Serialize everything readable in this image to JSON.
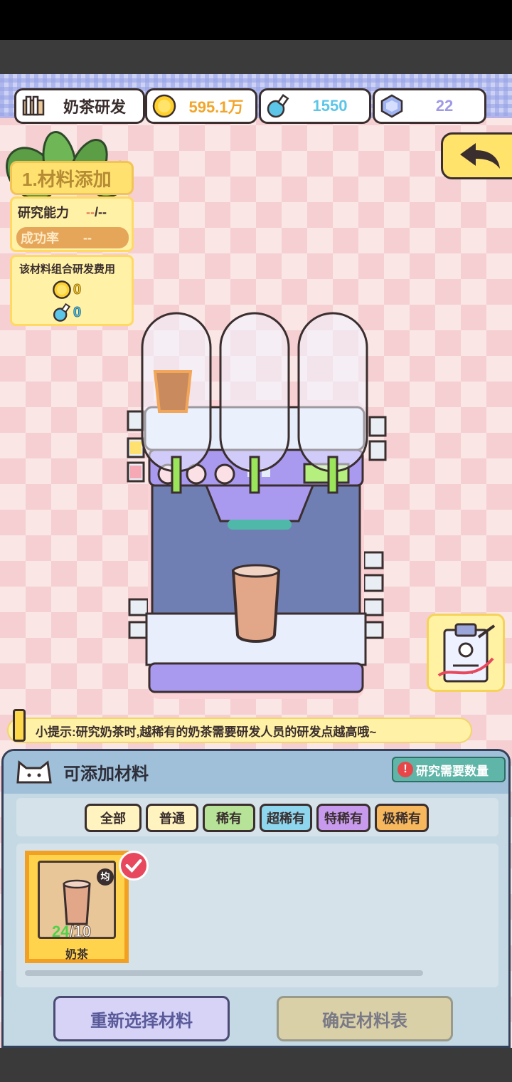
{
  "header": {
    "title": "奶茶研发",
    "coins": "595.1万",
    "potion": "1550",
    "gems": "22"
  },
  "left_panel": {
    "step_title": "1.材料添加",
    "research_label": "研究能力",
    "research_value_a": "--",
    "research_value_b": "/--",
    "success_label": "成功率",
    "success_value": "--",
    "cost_title": "该材料组合研发费用",
    "cost_coin": "0",
    "cost_potion": "0"
  },
  "tip": {
    "text": "小提示:研究奶茶时,越稀有的奶茶需要研发人员的研发点越高哦~"
  },
  "materials": {
    "title": "可添加材料",
    "need_label": "研究需要数量",
    "filters": [
      {
        "label": "全部",
        "bg": "#fff3bf"
      },
      {
        "label": "普通",
        "bg": "#fff3bf"
      },
      {
        "label": "稀有",
        "bg": "#b6e398"
      },
      {
        "label": "超稀有",
        "bg": "#8dd6ee"
      },
      {
        "label": "特稀有",
        "bg": "#c79aee"
      },
      {
        "label": "极稀有",
        "bg": "#f7b85d"
      }
    ],
    "items": [
      {
        "name": "奶茶",
        "have": "24",
        "need": "/10",
        "badge": "均"
      }
    ]
  },
  "buttons": {
    "reselect": "重新选择材料",
    "confirm": "确定材料表"
  },
  "colors": {
    "accent_yellow": "#ffe36b",
    "machine_purple": "#a99af0",
    "coin_text": "#f2a52a",
    "potion_text": "#5cc6e8",
    "gem_text": "#9f9ae6"
  }
}
